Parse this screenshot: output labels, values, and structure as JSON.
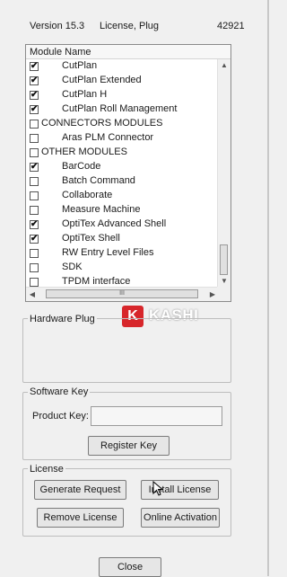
{
  "header": {
    "version": "Version 15.3",
    "license_type": "License, Plug",
    "number": "42921"
  },
  "modules": {
    "column_header": "Module Name",
    "items": [
      {
        "label": "CutPlan",
        "checked": true,
        "indent": true
      },
      {
        "label": "CutPlan Extended",
        "checked": true,
        "indent": true
      },
      {
        "label": "CutPlan H",
        "checked": true,
        "indent": true
      },
      {
        "label": "CutPlan Roll Management",
        "checked": true,
        "indent": true
      },
      {
        "label": "CONNECTORS MODULES",
        "checked": false,
        "indent": false
      },
      {
        "label": "Aras PLM Connector",
        "checked": false,
        "indent": true
      },
      {
        "label": "OTHER MODULES",
        "checked": false,
        "indent": false
      },
      {
        "label": "BarCode",
        "checked": true,
        "indent": true
      },
      {
        "label": "Batch Command",
        "checked": false,
        "indent": true
      },
      {
        "label": "Collaborate",
        "checked": false,
        "indent": true
      },
      {
        "label": "Measure Machine",
        "checked": false,
        "indent": true
      },
      {
        "label": "OptiTex Advanced Shell",
        "checked": true,
        "indent": true
      },
      {
        "label": "OptiTex Shell",
        "checked": true,
        "indent": true
      },
      {
        "label": "RW Entry Level Files",
        "checked": false,
        "indent": true
      },
      {
        "label": "SDK",
        "checked": false,
        "indent": true
      },
      {
        "label": "TPDM interface",
        "checked": false,
        "indent": true
      }
    ]
  },
  "hardware_plug": {
    "title": "Hardware Plug"
  },
  "software_key": {
    "title": "Software Key",
    "product_key_label": "Product Key:",
    "product_key_value": "",
    "register_button": "Register Key"
  },
  "license": {
    "title": "License",
    "generate_request": "Generate Request",
    "install_license": "Install License",
    "remove_license": "Remove License",
    "online_activation": "Online Activation"
  },
  "close_button": "Close",
  "watermark": {
    "badge": "K",
    "word": "KASHI",
    "badge_color": "#d7262b"
  },
  "icons": {
    "checkmark": "✔",
    "up": "▲",
    "down": "▼",
    "left": "◀",
    "right": "▶",
    "grip": "III"
  }
}
